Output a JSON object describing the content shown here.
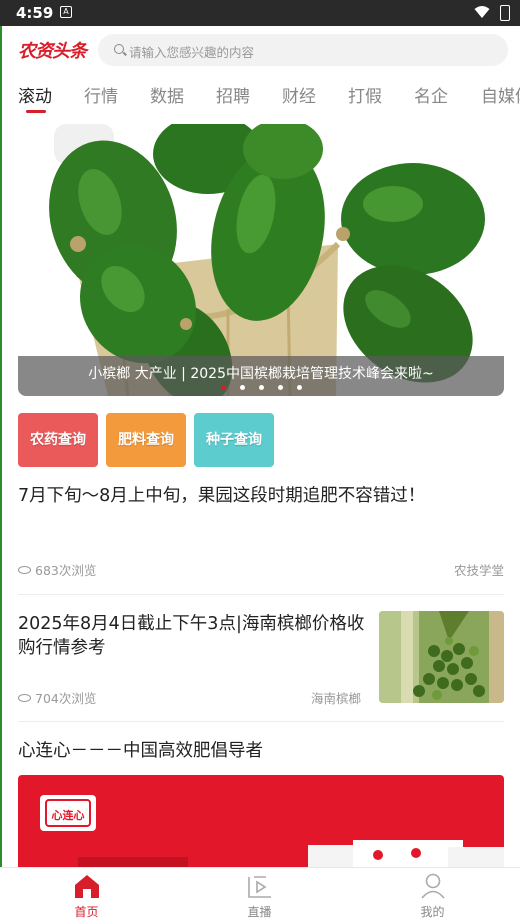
{
  "status_bar": {
    "time": "4:59",
    "notification_icon": "A"
  },
  "header": {
    "logo": "农资头条",
    "search_placeholder": "请输入您感兴趣的内容"
  },
  "tabs": [
    {
      "label": "滚动",
      "active": true
    },
    {
      "label": "行情"
    },
    {
      "label": "数据"
    },
    {
      "label": "招聘"
    },
    {
      "label": "财经"
    },
    {
      "label": "打假"
    },
    {
      "label": "名企"
    },
    {
      "label": "自媒体"
    }
  ],
  "banner": {
    "caption": "小槟榔 大产业 | 2025中国槟榔栽培管理技术峰会来啦~",
    "dot_count": 5,
    "active_dot": 0
  },
  "quick_links": [
    {
      "label": "农药查询",
      "color": "#ea5a5a"
    },
    {
      "label": "肥料查询",
      "color": "#f39a3d"
    },
    {
      "label": "种子查询",
      "color": "#5ccccf"
    }
  ],
  "articles": [
    {
      "title": "7月下旬～8月上中旬，果园这段时期追肥不容错过！",
      "views": "683次浏览",
      "source": "农技学堂"
    },
    {
      "title": "2025年8月4日截止下午3点|海南槟榔价格收购行情参考",
      "views": "704次浏览",
      "source": "海南槟榔"
    },
    {
      "title": "心连心－－－中国高效肥倡导者"
    }
  ],
  "ad": {
    "brand": "心连心"
  },
  "bottom_nav": [
    {
      "label": "首页",
      "icon": "home-icon",
      "active": true
    },
    {
      "label": "直播",
      "icon": "live-icon"
    },
    {
      "label": "我的",
      "icon": "profile-icon"
    }
  ],
  "colors": {
    "accent": "#d81e2a",
    "tab_inactive": "#888888",
    "meta": "#999999"
  }
}
